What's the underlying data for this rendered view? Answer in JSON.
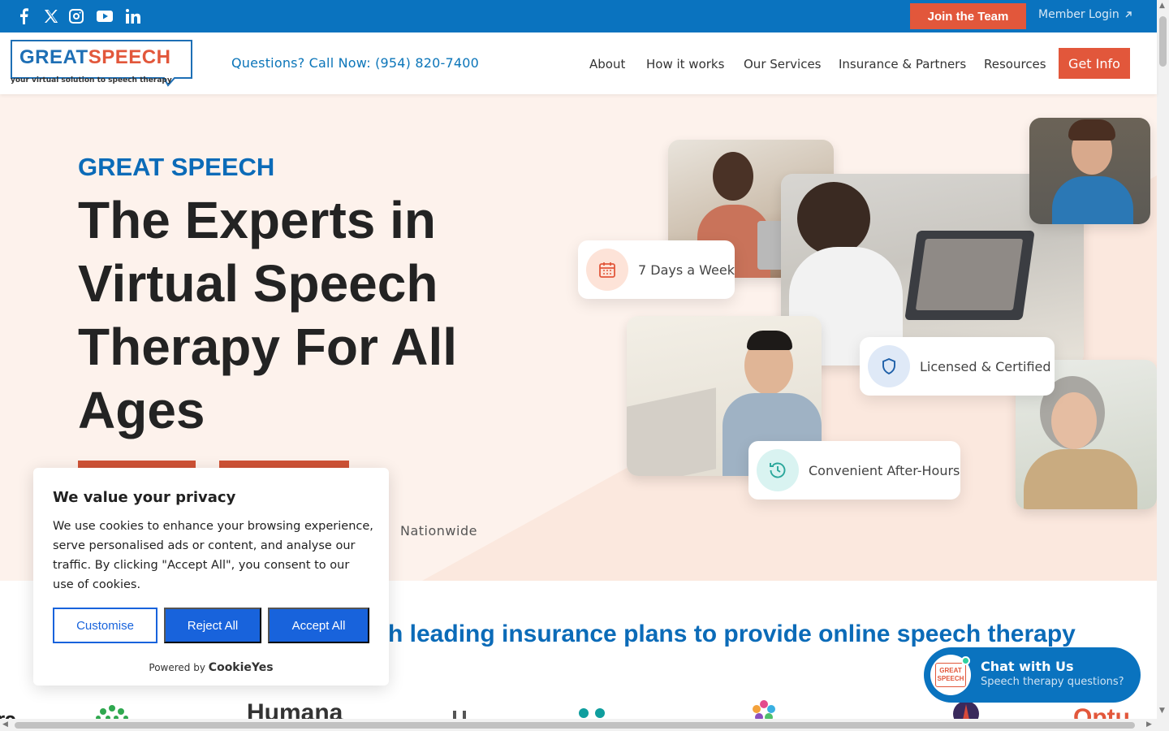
{
  "topbar": {
    "social_icons": [
      "facebook-icon",
      "x-icon",
      "instagram-icon",
      "youtube-icon",
      "linkedin-icon"
    ],
    "join_label": "Join the Team",
    "member_login_label": "Member Login",
    "bg_color": "#0a73bf"
  },
  "header": {
    "logo_text_a": "GREAT",
    "logo_text_b": "SPEECH",
    "logo_tagline": "your virtual solution to speech therapy",
    "phone_text": "Questions? Call Now: (954) 820-7400",
    "nav": [
      "About",
      "How it works",
      "Our Services",
      "Insurance & Partners",
      "Resources"
    ],
    "cta_label": "Get Info"
  },
  "hero": {
    "eyebrow": "GREAT SPEECH",
    "headline": "The Experts in Virtual Speech Therapy For All Ages",
    "nationwide": "Nationwide",
    "pills": {
      "days": "7 Days a Week",
      "licensed": "Licensed & Certified",
      "after_hours": "Convenient After-Hours"
    },
    "accent_color": "#e2573b"
  },
  "insurance": {
    "title": "h leading insurance plans to provide online speech therapy",
    "logo_fragment": "Humana"
  },
  "cookie": {
    "title": "We value your privacy",
    "body": "We use cookies to enhance your browsing experience, serve personalised ads or content, and analyse our traffic. By clicking \"Accept All\", you consent to our use of cookies.",
    "customise": "Customise",
    "reject": "Reject All",
    "accept": "Accept All",
    "powered_by": "Powered by",
    "brand": "CookieYes"
  },
  "chat": {
    "title": "Chat with Us",
    "subtitle": "Speech therapy questions?",
    "avatar_a": "GREAT",
    "avatar_b": "SPEECH"
  }
}
